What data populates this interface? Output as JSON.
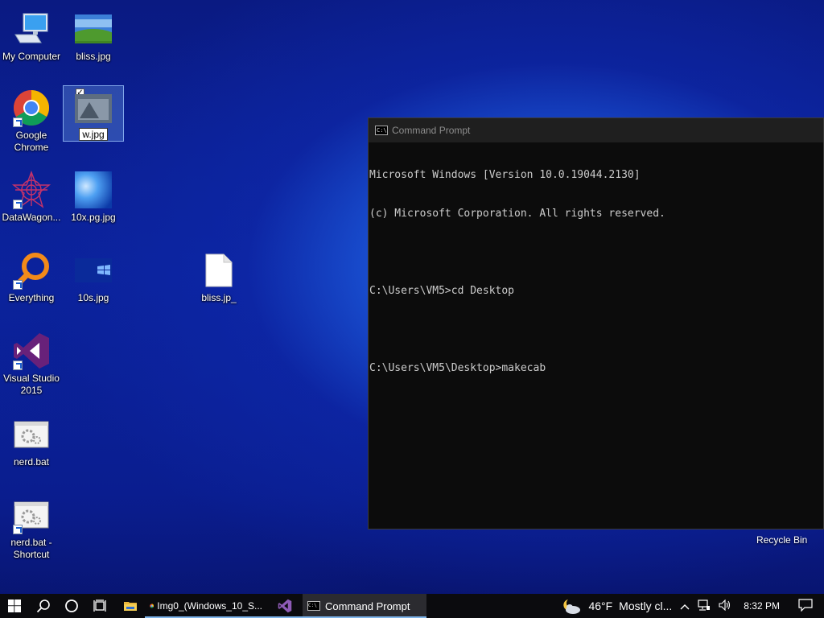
{
  "desktop": {
    "icons": [
      {
        "id": "my-computer",
        "label": "My Computer"
      },
      {
        "id": "bliss",
        "label": "bliss.jpg"
      },
      {
        "id": "chrome",
        "label": "Google Chrome"
      },
      {
        "id": "wjpg",
        "label": "w.jpg"
      },
      {
        "id": "datawagon",
        "label": "DataWagon..."
      },
      {
        "id": "tenx",
        "label": "10x.pg.jpg"
      },
      {
        "id": "everything",
        "label": "Everything"
      },
      {
        "id": "tens",
        "label": "10s.jpg"
      },
      {
        "id": "blissjp",
        "label": "bliss.jp_"
      },
      {
        "id": "vs",
        "label": "Visual Studio 2015"
      },
      {
        "id": "nerdbat",
        "label": "nerd.bat"
      },
      {
        "id": "nerdbat-shortcut",
        "label": "nerd.bat - Shortcut"
      }
    ],
    "recycle_bin": "Recycle Bin"
  },
  "cmd": {
    "title": "Command Prompt",
    "lines": [
      "Microsoft Windows [Version 10.0.19044.2130]",
      "(c) Microsoft Corporation. All rights reserved.",
      "",
      "C:\\Users\\VM5>cd Desktop",
      "",
      "C:\\Users\\VM5\\Desktop>makecab"
    ]
  },
  "taskbar": {
    "chrome_app": "Img0_(Windows_10_S...",
    "cmd_app": "Command Prompt",
    "weather_temp": "46°F",
    "weather_desc": "Mostly cl...",
    "time": "8:32 PM"
  },
  "colors": {
    "taskbar_bg": "#0b0b0e",
    "active_underline": "#7eb4ea",
    "cmd_bg": "#0c0c0c",
    "cmd_text": "#cccccc"
  }
}
